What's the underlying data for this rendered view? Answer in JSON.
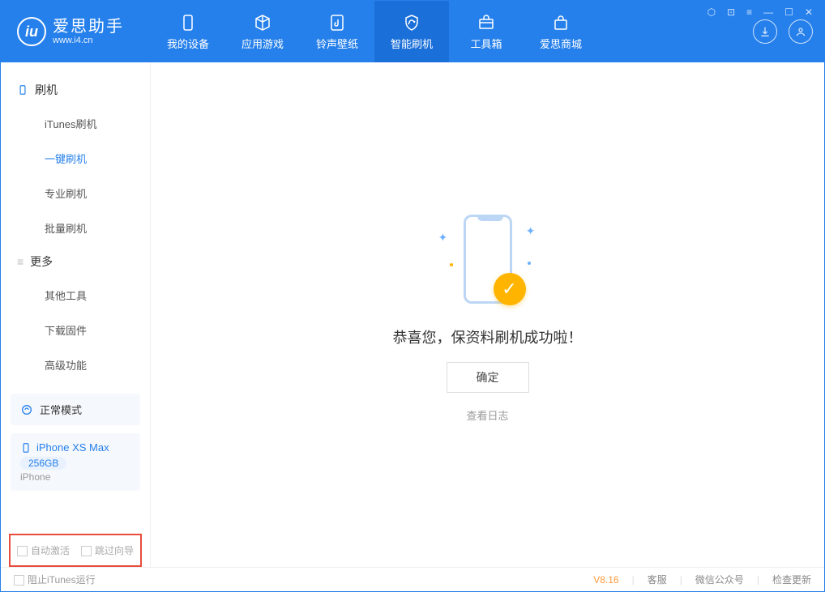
{
  "app": {
    "title": "爱思助手",
    "subtitle": "www.i4.cn"
  },
  "nav": {
    "items": [
      {
        "label": "我的设备"
      },
      {
        "label": "应用游戏"
      },
      {
        "label": "铃声壁纸"
      },
      {
        "label": "智能刷机"
      },
      {
        "label": "工具箱"
      },
      {
        "label": "爱思商城"
      }
    ]
  },
  "sidebar": {
    "section1_title": "刷机",
    "section1_items": [
      "iTunes刷机",
      "一键刷机",
      "专业刷机",
      "批量刷机"
    ],
    "section2_title": "更多",
    "section2_items": [
      "其他工具",
      "下载固件",
      "高级功能"
    ],
    "mode_label": "正常模式",
    "device": {
      "name": "iPhone XS Max",
      "storage": "256GB",
      "type": "iPhone"
    },
    "bottom": {
      "auto_activate": "自动激活",
      "skip_guide": "跳过向导"
    }
  },
  "main": {
    "success_text": "恭喜您，保资料刷机成功啦！",
    "ok_button": "确定",
    "view_log": "查看日志"
  },
  "footer": {
    "block_itunes": "阻止iTunes运行",
    "version": "V8.16",
    "links": [
      "客服",
      "微信公众号",
      "检查更新"
    ]
  }
}
